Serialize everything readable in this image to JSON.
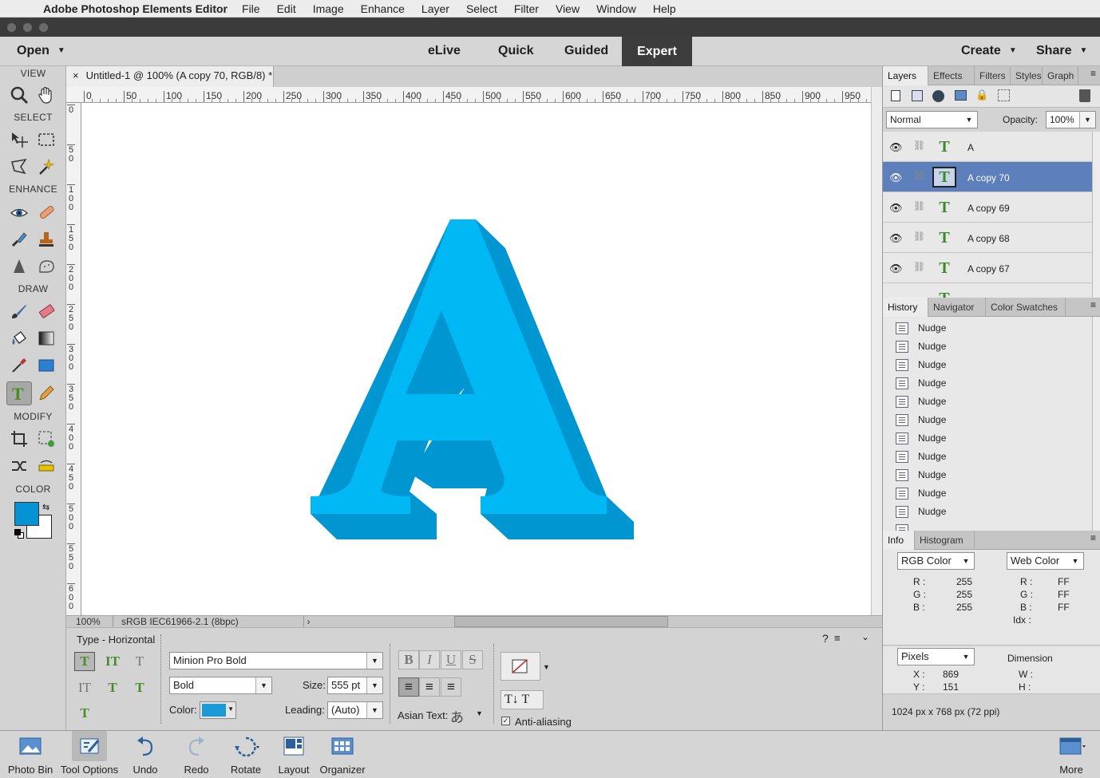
{
  "menubar": {
    "app_name": "Adobe Photoshop Elements Editor",
    "items": [
      "File",
      "Edit",
      "Image",
      "Enhance",
      "Layer",
      "Select",
      "Filter",
      "View",
      "Window",
      "Help"
    ]
  },
  "modebar": {
    "open": "Open",
    "tabs": [
      "eLive",
      "Quick",
      "Guided",
      "Expert"
    ],
    "active_tab": "Expert",
    "create": "Create",
    "share": "Share"
  },
  "toolbox": {
    "sections": [
      "VIEW",
      "SELECT",
      "ENHANCE",
      "DRAW",
      "MODIFY",
      "COLOR"
    ],
    "foreground_color": "#0693d3",
    "background_color": "#ffffff"
  },
  "document": {
    "tab_title": "Untitled-1 @ 100% (A copy 70, RGB/8) *",
    "ruler_top": [
      "0",
      "50",
      "100",
      "150",
      "200",
      "250",
      "300",
      "350",
      "400",
      "450",
      "500",
      "550",
      "600",
      "650",
      "700",
      "750",
      "800",
      "850",
      "900",
      "950"
    ],
    "ruler_left": [
      "0",
      "50",
      "100",
      "150",
      "200",
      "250",
      "300",
      "350",
      "400",
      "450",
      "500",
      "550",
      "600"
    ],
    "zoom": "100%",
    "profile": "sRGB IEC61966-2.1 (8bpc)",
    "letter_front_color": "#00b8f4",
    "letter_side_color": "#0096d2"
  },
  "options": {
    "title": "Type - Horizontal",
    "font_family": "Minion Pro Bold",
    "font_style": "Bold",
    "size_label": "Size:",
    "size_value": "555 pt",
    "color_label": "Color:",
    "color_value": "#1a9ad6",
    "leading_label": "Leading:",
    "leading_value": "(Auto)",
    "asian_text_label": "Asian Text:",
    "antialias_label": "Anti-aliasing",
    "antialias_checked": true
  },
  "layers_panel": {
    "tabs": [
      "Layers",
      "Effects",
      "Filters",
      "Styles",
      "Graph"
    ],
    "blend_mode": "Normal",
    "opacity_label": "Opacity:",
    "opacity_value": "100%",
    "layers": [
      {
        "name": "A",
        "selected": false
      },
      {
        "name": "A copy 70",
        "selected": true
      },
      {
        "name": "A copy 69",
        "selected": false
      },
      {
        "name": "A copy 68",
        "selected": false
      },
      {
        "name": "A copy 67",
        "selected": false
      }
    ]
  },
  "history_panel": {
    "tabs": [
      "History",
      "Navigator",
      "Color Swatches"
    ],
    "items": [
      "Nudge",
      "Nudge",
      "Nudge",
      "Nudge",
      "Nudge",
      "Nudge",
      "Nudge",
      "Nudge",
      "Nudge",
      "Nudge",
      "Nudge"
    ]
  },
  "info_panel": {
    "tabs": [
      "Info",
      "Histogram"
    ],
    "mode_left": "RGB Color",
    "mode_right": "Web Color",
    "rgb_labels": [
      "R :",
      "G :",
      "B :"
    ],
    "rgb_values": [
      "255",
      "255",
      "255"
    ],
    "web_labels": [
      "R :",
      "G :",
      "B :",
      "Idx :"
    ],
    "web_values": [
      "FF",
      "FF",
      "FF",
      ""
    ],
    "units": "Pixels",
    "dimension_label": "Dimension",
    "xy_labels": [
      "X :",
      "Y :"
    ],
    "xy_values": [
      "869",
      "151"
    ],
    "wh_labels": [
      "W :",
      "H :"
    ],
    "doc_size": "1024 px x 768 px (72 ppi)"
  },
  "bottombar": {
    "photo_bin": "Photo Bin",
    "tool_options": "Tool Options",
    "undo": "Undo",
    "redo": "Redo",
    "rotate": "Rotate",
    "layout": "Layout",
    "organizer": "Organizer",
    "more": "More"
  }
}
